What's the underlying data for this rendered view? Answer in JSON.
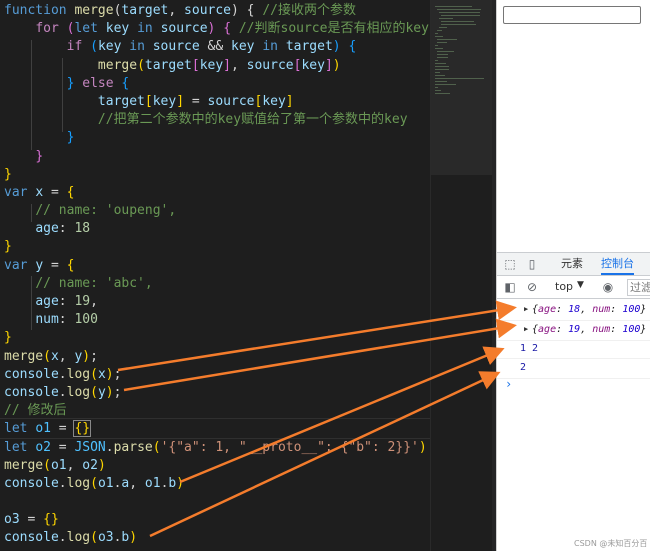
{
  "editor": {
    "lines": [
      [
        [
          "kw",
          "function "
        ],
        [
          "fn",
          "merge"
        ],
        [
          "p",
          "("
        ],
        [
          "vr",
          "target"
        ],
        [
          "p",
          ", "
        ],
        [
          "vr",
          "source"
        ],
        [
          "p",
          ") { "
        ],
        [
          "cm",
          "//接收两个参数"
        ]
      ],
      [
        [
          "p",
          "    "
        ],
        [
          "ctl",
          "for "
        ],
        [
          "b2",
          "("
        ],
        [
          "kw",
          "let "
        ],
        [
          "vr",
          "key"
        ],
        [
          "kw",
          " in "
        ],
        [
          "vr",
          "source"
        ],
        [
          "b2",
          ")"
        ],
        [
          "p",
          " "
        ],
        [
          "b2",
          "{"
        ],
        [
          "p",
          " "
        ],
        [
          "cm",
          "//判断source是否有相应的key"
        ]
      ],
      [
        [
          "p",
          "        "
        ],
        [
          "ctl",
          "if "
        ],
        [
          "b3",
          "("
        ],
        [
          "vr",
          "key"
        ],
        [
          "kw",
          " in "
        ],
        [
          "vr",
          "source"
        ],
        [
          "p",
          " && "
        ],
        [
          "vr",
          "key"
        ],
        [
          "kw",
          " in "
        ],
        [
          "vr",
          "target"
        ],
        [
          "b3",
          ")"
        ],
        [
          "p",
          " "
        ],
        [
          "b3",
          "{"
        ]
      ],
      [
        [
          "p",
          "            "
        ],
        [
          "fn",
          "merge"
        ],
        [
          "b1",
          "("
        ],
        [
          "vr",
          "target"
        ],
        [
          "b2",
          "["
        ],
        [
          "vr",
          "key"
        ],
        [
          "b2",
          "]"
        ],
        [
          "p",
          ", "
        ],
        [
          "vr",
          "source"
        ],
        [
          "b2",
          "["
        ],
        [
          "vr",
          "key"
        ],
        [
          "b2",
          "]"
        ],
        [
          "b1",
          ")"
        ]
      ],
      [
        [
          "p",
          "        "
        ],
        [
          "b3",
          "}"
        ],
        [
          "ctl",
          " else "
        ],
        [
          "b3",
          "{"
        ]
      ],
      [
        [
          "p",
          "            "
        ],
        [
          "vr",
          "target"
        ],
        [
          "b1",
          "["
        ],
        [
          "vr",
          "key"
        ],
        [
          "b1",
          "]"
        ],
        [
          "p",
          " = "
        ],
        [
          "vr",
          "source"
        ],
        [
          "b1",
          "["
        ],
        [
          "vr",
          "key"
        ],
        [
          "b1",
          "]"
        ]
      ],
      [
        [
          "p",
          "            "
        ],
        [
          "cm",
          "//把第二个参数中的key赋值给了第一个参数中的key"
        ]
      ],
      [
        [
          "p",
          "        "
        ],
        [
          "b3",
          "}"
        ]
      ],
      [
        [
          "p",
          "    "
        ],
        [
          "b2",
          "}"
        ]
      ],
      [
        [
          "b1",
          "}"
        ]
      ],
      [
        [
          "kw",
          "var "
        ],
        [
          "vr",
          "x"
        ],
        [
          "p",
          " = "
        ],
        [
          "b1",
          "{"
        ]
      ],
      [
        [
          "p",
          "    "
        ],
        [
          "cm",
          "// name: 'oupeng',"
        ]
      ],
      [
        [
          "p",
          "    "
        ],
        [
          "vr",
          "age"
        ],
        [
          "p",
          ": "
        ],
        [
          "num",
          "18"
        ]
      ],
      [
        [
          "b1",
          "}"
        ]
      ],
      [
        [
          "kw",
          "var "
        ],
        [
          "vr",
          "y"
        ],
        [
          "p",
          " = "
        ],
        [
          "b1",
          "{"
        ]
      ],
      [
        [
          "p",
          "    "
        ],
        [
          "cm",
          "// name: 'abc',"
        ]
      ],
      [
        [
          "p",
          "    "
        ],
        [
          "vr",
          "age"
        ],
        [
          "p",
          ": "
        ],
        [
          "num",
          "19"
        ],
        [
          "p",
          ","
        ]
      ],
      [
        [
          "p",
          "    "
        ],
        [
          "vr",
          "num"
        ],
        [
          "p",
          ": "
        ],
        [
          "num",
          "100"
        ]
      ],
      [
        [
          "b1",
          "}"
        ]
      ],
      [
        [
          "fn",
          "merge"
        ],
        [
          "b1",
          "("
        ],
        [
          "vr",
          "x"
        ],
        [
          "p",
          ", "
        ],
        [
          "vr",
          "y"
        ],
        [
          "b1",
          ")"
        ],
        [
          "p",
          ";"
        ]
      ],
      [
        [
          "vr",
          "console"
        ],
        [
          "p",
          "."
        ],
        [
          "fn",
          "log"
        ],
        [
          "b1",
          "("
        ],
        [
          "vr",
          "x"
        ],
        [
          "b1",
          ")"
        ],
        [
          "p",
          ";"
        ]
      ],
      [
        [
          "vr",
          "console"
        ],
        [
          "p",
          "."
        ],
        [
          "fn",
          "log"
        ],
        [
          "b1",
          "("
        ],
        [
          "vr",
          "y"
        ],
        [
          "b1",
          ")"
        ],
        [
          "p",
          ";"
        ]
      ],
      [
        [
          "cm",
          "// 修改后"
        ]
      ],
      [
        [
          "kw",
          "let "
        ],
        [
          "cn",
          "o1"
        ],
        [
          "p",
          " = "
        ],
        [
          "b1",
          "{}"
        ]
      ],
      [
        [
          "kw",
          "let "
        ],
        [
          "cn",
          "o2"
        ],
        [
          "p",
          " = "
        ],
        [
          "cn",
          "JSON"
        ],
        [
          "p",
          "."
        ],
        [
          "fn",
          "parse"
        ],
        [
          "b1",
          "("
        ],
        [
          "str",
          "'{\"a\": 1, \"__proto__\": {\"b\": 2}}'"
        ],
        [
          "b1",
          ")"
        ]
      ],
      [
        [
          "fn",
          "merge"
        ],
        [
          "b1",
          "("
        ],
        [
          "vr",
          "o1"
        ],
        [
          "p",
          ", "
        ],
        [
          "vr",
          "o2"
        ],
        [
          "b1",
          ")"
        ]
      ],
      [
        [
          "vr",
          "console"
        ],
        [
          "p",
          "."
        ],
        [
          "fn",
          "log"
        ],
        [
          "b1",
          "("
        ],
        [
          "vr",
          "o1"
        ],
        [
          "p",
          "."
        ],
        [
          "vr",
          "a"
        ],
        [
          "p",
          ", "
        ],
        [
          "vr",
          "o1"
        ],
        [
          "p",
          "."
        ],
        [
          "vr",
          "b"
        ],
        [
          "b1",
          ")"
        ]
      ],
      [
        [
          "p",
          ""
        ]
      ],
      [
        [
          "vr",
          "o3"
        ],
        [
          "p",
          " = "
        ],
        [
          "b1",
          "{}"
        ]
      ],
      [
        [
          "vr",
          "console"
        ],
        [
          "p",
          "."
        ],
        [
          "fn",
          "log"
        ],
        [
          "b1",
          "("
        ],
        [
          "vr",
          "o3"
        ],
        [
          "p",
          "."
        ],
        [
          "vr",
          "b"
        ],
        [
          "b1",
          ")"
        ]
      ]
    ]
  },
  "devtools": {
    "tab_elements": "元素",
    "tab_console": "控制台",
    "context": "top",
    "filter_placeholder": "过滤",
    "output": {
      "row1": {
        "open": "{",
        "k1": "age",
        "v1": "18",
        "k2": "num",
        "v2": "100",
        "close": "}"
      },
      "row2": {
        "open": "{",
        "k1": "age",
        "v1": "19",
        "k2": "num",
        "v2": "100",
        "close": "}"
      },
      "row3": "1 2",
      "row4": "2"
    },
    "prompt": "›"
  },
  "annotation_color": "#f47c2c",
  "watermark": "CSDN @未知百分百"
}
